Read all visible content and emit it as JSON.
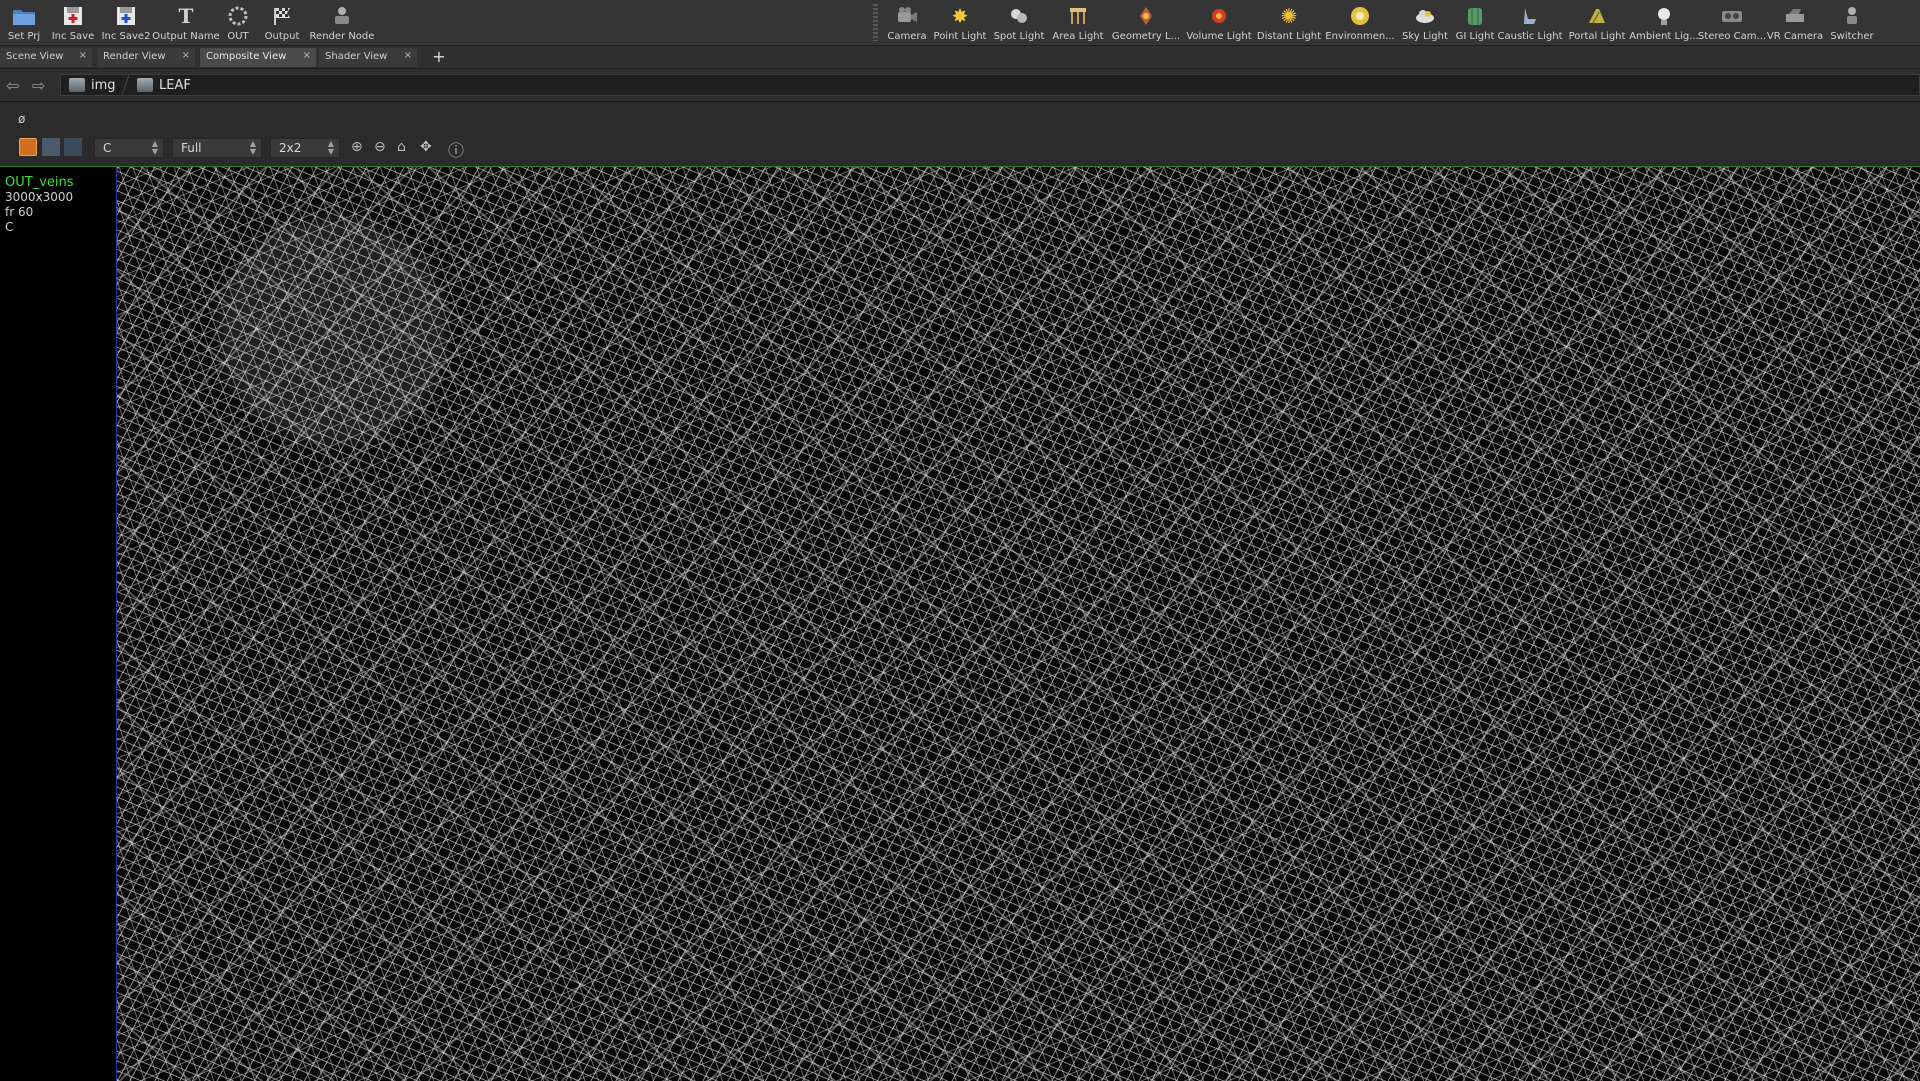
{
  "shelf": {
    "left_tools": [
      {
        "label": "Set Prj",
        "icon": "folder-icon"
      },
      {
        "label": "Inc Save",
        "icon": "save-plus-icon"
      },
      {
        "label": "Inc Save2",
        "icon": "save-plus-icon"
      },
      {
        "label": "Output Name",
        "icon": "text-t-icon"
      },
      {
        "label": "OUT",
        "icon": "circle-ring-icon"
      },
      {
        "label": "Output",
        "icon": "checkered-flag-icon"
      },
      {
        "label": "Render Node",
        "icon": "render-node-icon"
      }
    ],
    "right_tools": [
      {
        "label": "Camera",
        "icon": "camera-icon"
      },
      {
        "label": "Point Light",
        "icon": "point-light-icon"
      },
      {
        "label": "Spot Light",
        "icon": "spot-light-icon"
      },
      {
        "label": "Area Light",
        "icon": "area-light-icon"
      },
      {
        "label": "Geometry L...",
        "icon": "geometry-light-icon"
      },
      {
        "label": "Volume Light",
        "icon": "volume-light-icon"
      },
      {
        "label": "Distant Light",
        "icon": "distant-light-icon"
      },
      {
        "label": "Environmen...",
        "icon": "environment-light-icon"
      },
      {
        "label": "Sky Light",
        "icon": "sky-light-icon"
      },
      {
        "label": "GI Light",
        "icon": "gi-light-icon"
      },
      {
        "label": "Caustic Light",
        "icon": "caustic-light-icon"
      },
      {
        "label": "Portal Light",
        "icon": "portal-light-icon"
      },
      {
        "label": "Ambient Lig...",
        "icon": "ambient-light-icon"
      },
      {
        "label": "Stereo Cam...",
        "icon": "stereo-camera-icon"
      },
      {
        "label": "VR Camera",
        "icon": "vr-camera-icon"
      },
      {
        "label": "Switcher",
        "icon": "switcher-icon"
      }
    ]
  },
  "tabs": [
    {
      "label": "Scene View",
      "active": false
    },
    {
      "label": "Render View",
      "active": false
    },
    {
      "label": "Composite View",
      "active": true
    },
    {
      "label": "Shader View",
      "active": false
    }
  ],
  "tab_close": "×",
  "tab_add": "+",
  "path": {
    "crumbs": [
      "img",
      "LEAF"
    ]
  },
  "viewer": {
    "phi": "ø",
    "plane": "C",
    "resolution": "Full",
    "tiling": "2x2"
  },
  "image_info": {
    "node_name": "OUT_veins",
    "size": "3000x3000",
    "frame": "fr 60",
    "plane": "C"
  },
  "colors": {
    "accent": "#38e038",
    "active_tab": "#4a4a4a",
    "viewport_bg": "#000000"
  }
}
